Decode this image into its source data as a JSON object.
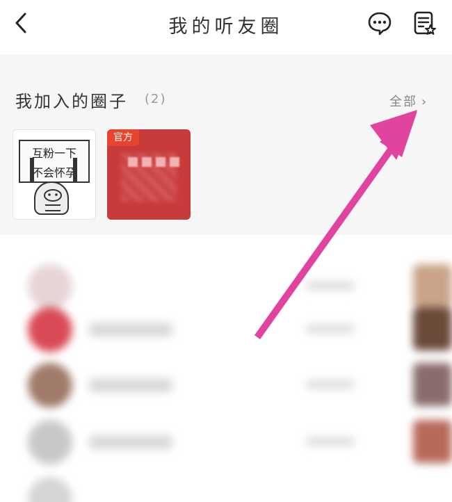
{
  "header": {
    "title": "我的听友圈",
    "back_icon": "chevron-left-icon",
    "chat_icon": "chat-bubble-icon",
    "note_icon": "note-star-icon"
  },
  "section": {
    "title": "我加入的圈子",
    "count": "(2)",
    "view_all": "全部",
    "view_all_chevron": "›"
  },
  "circles": [
    {
      "sign_line1": "互粉一下",
      "sign_line2": "不会怀孕"
    },
    {
      "badge": "官方"
    }
  ],
  "colors": {
    "accent_red": "#e8432f",
    "arrow_pink": "#e0449e"
  }
}
